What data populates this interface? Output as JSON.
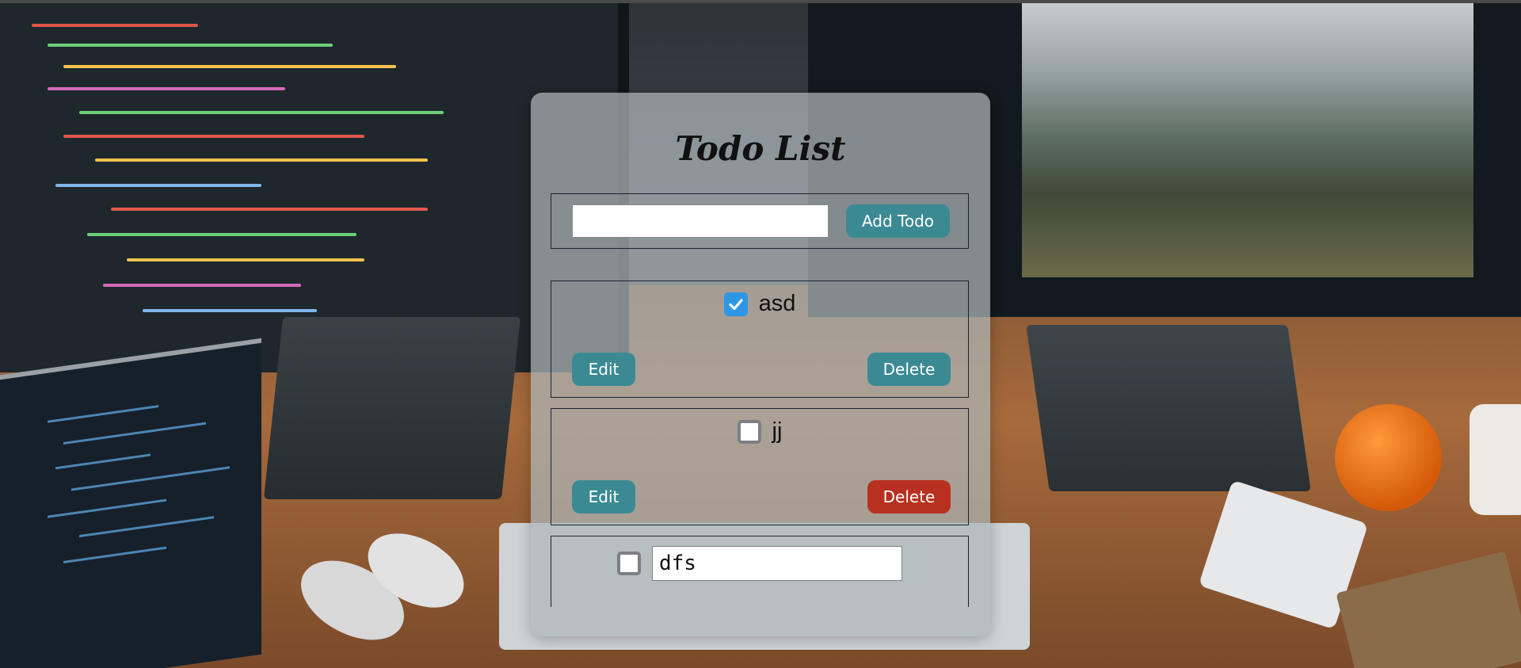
{
  "app": {
    "title": "Todo List"
  },
  "add_form": {
    "input_value": "",
    "input_placeholder": "",
    "add_button_label": "Add Todo"
  },
  "todos": [
    {
      "text": "asd",
      "completed": true,
      "edit_label": "Edit",
      "delete_label": "Delete"
    },
    {
      "text": "jj",
      "completed": false,
      "edit_label": "Edit",
      "delete_label": "Delete"
    },
    {
      "text": "dfs",
      "completed": false,
      "editing": true
    }
  ],
  "colors": {
    "button": "#3b8a93",
    "delete_active": "#b8301f",
    "checkbox_checked": "#2f96e6"
  },
  "background": {
    "description_icon": "desk-setup-background"
  }
}
